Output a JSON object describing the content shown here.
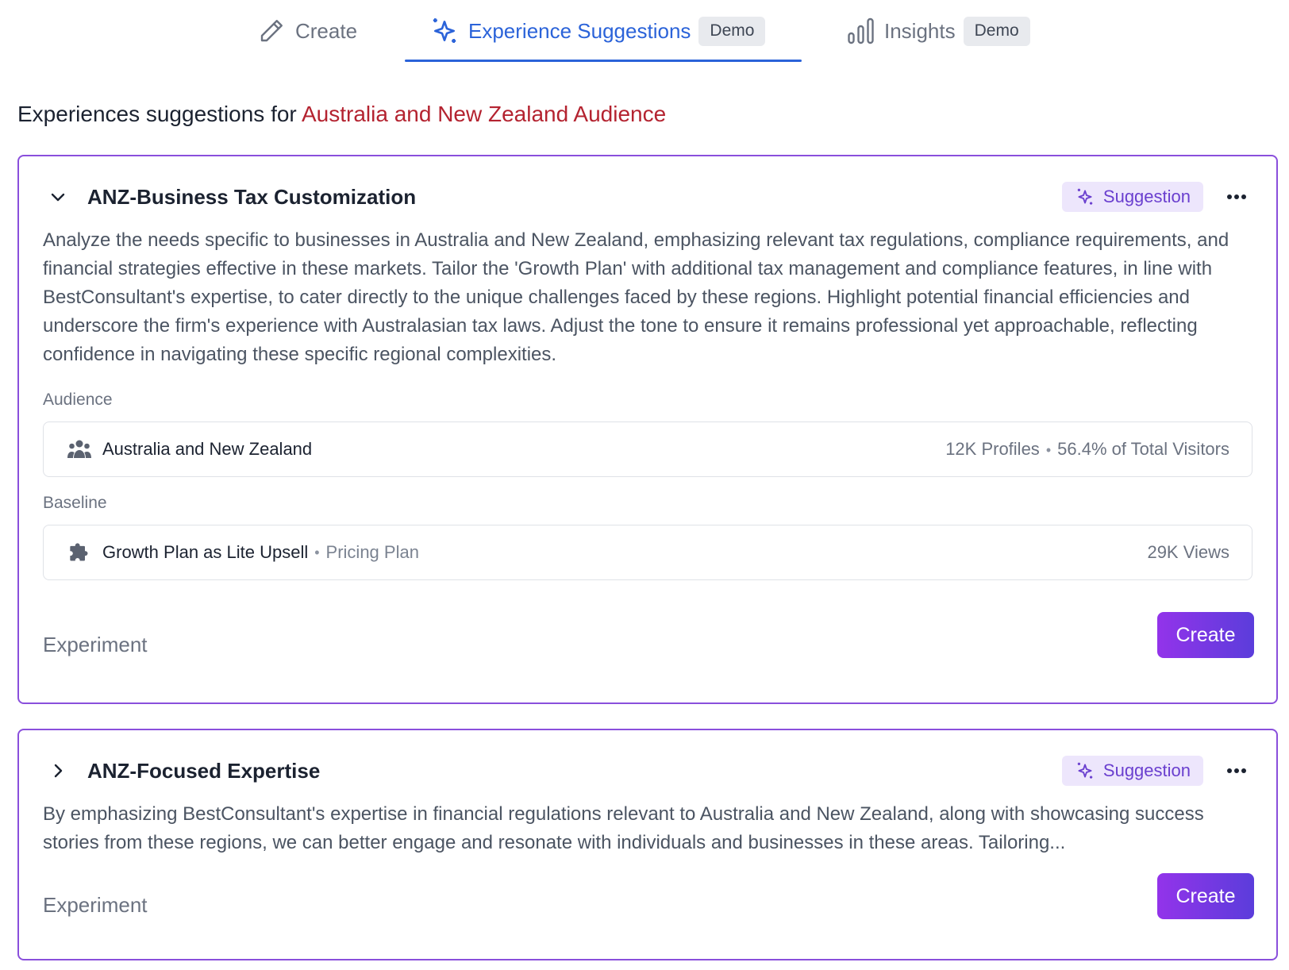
{
  "tabs": [
    {
      "label": "Create",
      "icon": "pencil-icon",
      "active": false,
      "badge": ""
    },
    {
      "label": "Experience Suggestions",
      "icon": "sparkles-icon",
      "active": true,
      "badge": "Demo"
    },
    {
      "label": "Insights",
      "icon": "bar-chart-icon",
      "active": false,
      "badge": "Demo"
    }
  ],
  "heading": {
    "prefix": "Experiences suggestions for",
    "highlight": "Australia and New Zealand Audience"
  },
  "colors": {
    "accent_blue": "#2b63d9",
    "highlight_red": "#b42330",
    "card_border": "#8a4fdc",
    "suggestion_badge_bg": "#ede6fc",
    "suggestion_badge_text": "#6a3fcf",
    "button_gradient_start": "#9333ea",
    "button_gradient_end": "#5b3ddb"
  },
  "cards": [
    {
      "title": "ANZ-Business Tax Customization",
      "expanded": true,
      "badge": "Suggestion",
      "description": "Analyze the needs specific to businesses in Australia and New Zealand, emphasizing relevant tax regulations, compliance requirements, and financial strategies effective in these markets. Tailor the 'Growth Plan' with additional tax management and compliance features, in line with BestConsultant's expertise, to cater directly to the unique challenges faced by these regions. Highlight potential financial efficiencies and underscore the firm's experience with Australasian tax laws. Adjust the tone to ensure it remains professional yet approachable, reflecting confidence in navigating these specific regional complexities.",
      "audience_label": "Audience",
      "audience": {
        "icon": "users-icon",
        "name": "Australia and New Zealand",
        "profiles": "12K Profiles",
        "share": "56.4% of Total Visitors"
      },
      "baseline_label": "Baseline",
      "baseline": {
        "icon": "puzzle-icon",
        "name": "Growth Plan as Lite Upsell",
        "type": "Pricing Plan",
        "views": "29K Views"
      },
      "type_label": "Experiment",
      "create_label": "Create"
    },
    {
      "title": "ANZ-Focused Expertise",
      "expanded": false,
      "badge": "Suggestion",
      "description": "By emphasizing BestConsultant's expertise in financial regulations relevant to Australia and New Zealand, along with showcasing success stories from these regions, we can better engage and resonate with individuals and businesses in these areas. Tailoring...",
      "type_label": "Experiment",
      "create_label": "Create"
    }
  ]
}
